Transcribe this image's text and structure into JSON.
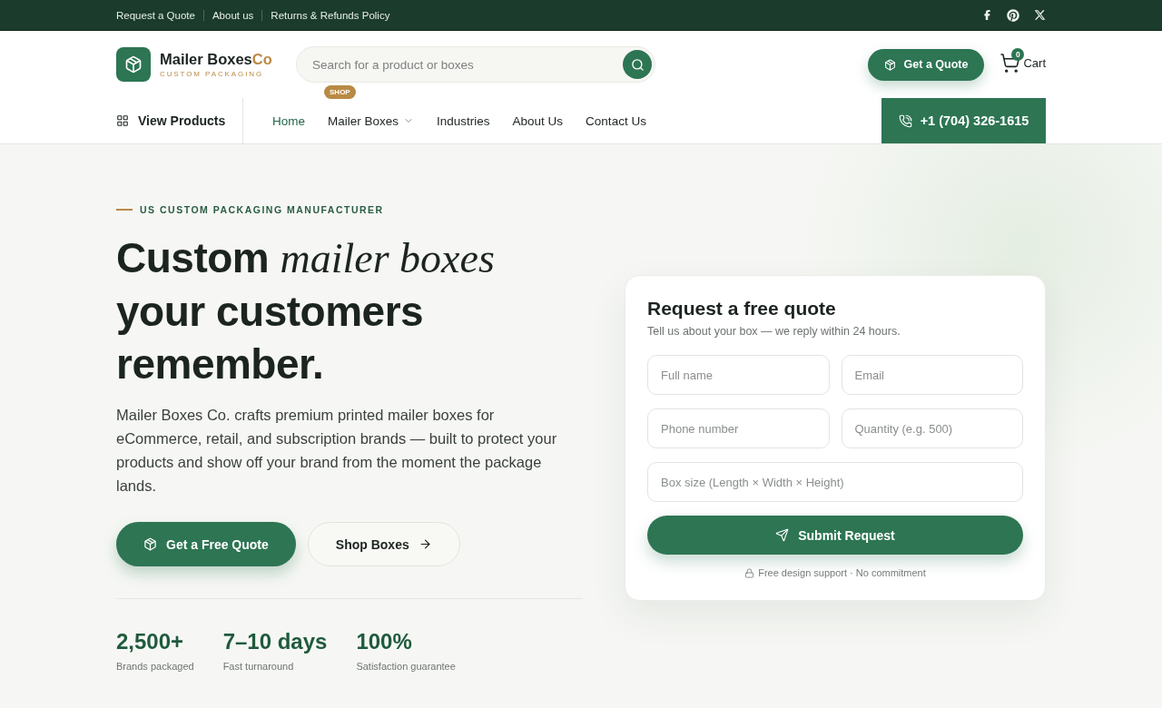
{
  "top_bar": {
    "links": [
      "Request a Quote",
      "About us",
      "Returns & Refunds Policy"
    ]
  },
  "header": {
    "brand": {
      "name": "Mailer Boxes",
      "accent": "Co",
      "tagline": "CUSTOM PACKAGING"
    },
    "search": {
      "placeholder": "Search for a product or boxes"
    },
    "quote_button": "Get a Quote",
    "cart": {
      "count": "0",
      "label": "Cart"
    }
  },
  "nav": {
    "catalog_button": "View Products",
    "items": [
      {
        "label": "Home",
        "selected": true,
        "dropdown": false
      },
      {
        "label": "Mailer Boxes",
        "selected": false,
        "dropdown": true,
        "badge": "SHOP"
      },
      {
        "label": "Industries",
        "selected": false,
        "dropdown": false
      },
      {
        "label": "About Us",
        "selected": false,
        "dropdown": false
      },
      {
        "label": "Contact Us",
        "selected": false,
        "dropdown": false
      }
    ],
    "phone": "+1 (704) 326-1615"
  },
  "hero": {
    "eyebrow": "US CUSTOM PACKAGING MANUFACTURER",
    "headline_lines": [
      "Custom *mailer boxes*",
      "your customers",
      "remember."
    ],
    "description": "Mailer Boxes Co. crafts premium printed mailer boxes for eCommerce, retail, and subscription brands — built to protect your products and show off your brand from the moment the package lands.",
    "buttons": [
      {
        "label": "Get a Free Quote",
        "kind": "primary"
      },
      {
        "label": "Shop Boxes",
        "kind": "secondary"
      }
    ],
    "stats": [
      {
        "value": "2,500+",
        "label": "Brands packaged"
      },
      {
        "value": "7–10 days",
        "label": "Fast turnaround"
      },
      {
        "value": "100%",
        "label": "Satisfaction guarantee"
      }
    ]
  },
  "quote_form": {
    "title": "Request a free quote",
    "subtitle": "Tell us about your box — we reply within 24 hours.",
    "field_rows": [
      [
        {
          "placeholder": "Full name"
        },
        {
          "placeholder": "Email"
        }
      ],
      [
        {
          "placeholder": "Phone number"
        },
        {
          "placeholder": "Quantity (e.g. 500)"
        }
      ],
      [
        {
          "placeholder": "Box size (Length × Width × Height)"
        }
      ]
    ],
    "submit": "Submit Request",
    "note": "Free design support · No commitment"
  }
}
